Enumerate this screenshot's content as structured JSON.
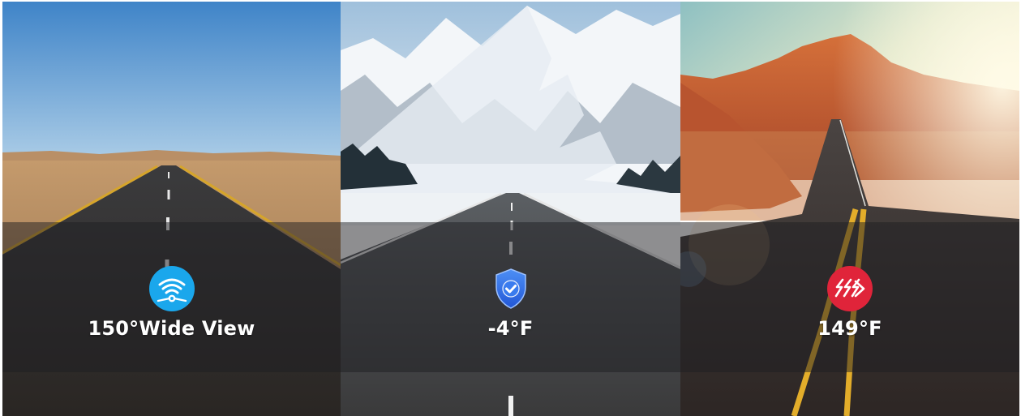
{
  "panels": [
    {
      "id": "desert",
      "caption": "150°Wide View",
      "icon": "wide-angle-icon",
      "icon_color": "#1AA7EC"
    },
    {
      "id": "snow",
      "caption": "-4°F",
      "icon": "shield-check-icon",
      "icon_color": "#2F6FE8"
    },
    {
      "id": "canyon",
      "caption": "149°F",
      "icon": "heat-waves-icon",
      "icon_color": "#E0243A"
    }
  ]
}
